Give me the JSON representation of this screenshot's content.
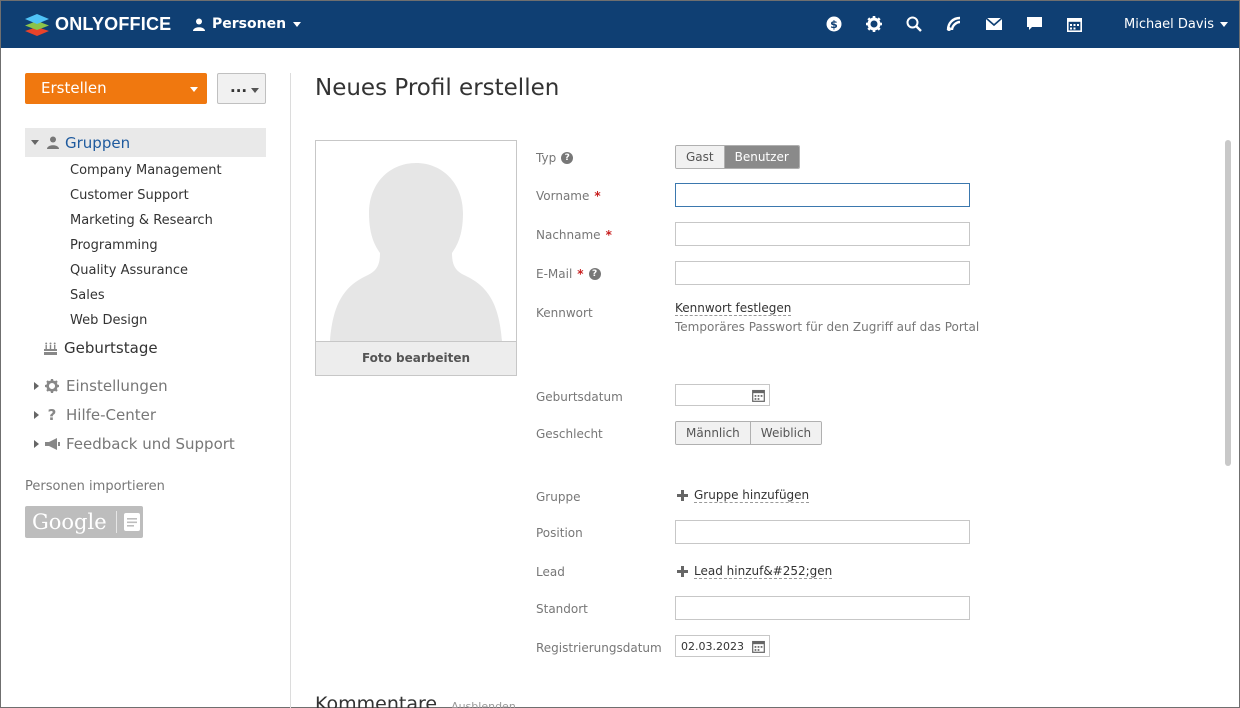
{
  "header": {
    "brand": "ONLYOFFICE",
    "module": "Personen",
    "user": "Michael Davis",
    "icons": [
      "billing-icon",
      "settings-icon",
      "search-icon",
      "feed-icon",
      "mail-icon",
      "chat-icon",
      "calendar-icon"
    ]
  },
  "sidebar": {
    "create_label": "Erstellen",
    "more_label": "...",
    "groups_label": "Gruppen",
    "groups": [
      "Company Management",
      "Customer Support",
      "Marketing & Research",
      "Programming",
      "Quality Assurance",
      "Sales",
      "Web Design"
    ],
    "birthdays": "Geburtstage",
    "settings": "Einstellungen",
    "help_center": "Hilfe-Center",
    "feedback": "Feedback und Support",
    "import_title": "Personen importieren",
    "google_label": "Google"
  },
  "form": {
    "title": "Neues Profil erstellen",
    "photo_caption": "Foto bearbeiten",
    "type_label": "Typ",
    "type_options": [
      "Gast",
      "Benutzer"
    ],
    "type_selected": "Benutzer",
    "firstname_label": "Vorname",
    "lastname_label": "Nachname",
    "email_label": "E-Mail",
    "password_label": "Kennwort",
    "password_link": "Kennwort festlegen",
    "password_hint": "Temporäres Passwort für den Zugriff auf das Portal",
    "birthday_label": "Geburtsdatum",
    "gender_label": "Geschlecht",
    "gender_options": [
      "Männlich",
      "Weiblich"
    ],
    "group_label": "Gruppe",
    "group_link": "Gruppe hinzufügen",
    "position_label": "Position",
    "lead_label": "Lead",
    "lead_link": "Lead hinzuf&#252;gen",
    "location_label": "Standort",
    "regdate_label": "Registrierungsdatum",
    "regdate_value": "02.03.2023",
    "comments_title": "Kommentare",
    "comments_hide": "Ausblenden"
  },
  "colors": {
    "topbar": "#0f3f73",
    "accent": "#f0780f",
    "link": "#1e5a9e"
  }
}
